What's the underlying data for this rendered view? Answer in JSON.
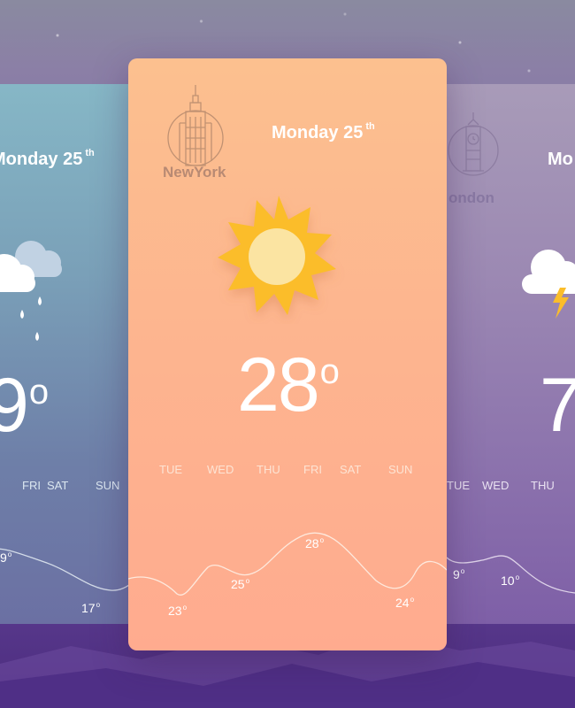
{
  "cards": {
    "left": {
      "date": "Monday 25",
      "date_suffix": "th",
      "temp_digit": "9",
      "temp_degree": "o",
      "days": [
        "FRI",
        "SAT",
        "SUN"
      ],
      "chart_labels": [
        {
          "value": "9",
          "deg": "o"
        },
        {
          "value": "17",
          "deg": "o"
        }
      ]
    },
    "center": {
      "date": "Monday 25",
      "date_suffix": "th",
      "city": "NewYork",
      "temp": "28",
      "temp_degree": "o",
      "days": [
        "TUE",
        "WED",
        "THU",
        "FRI",
        "SAT",
        "SUN"
      ],
      "chart_labels": [
        {
          "value": "23",
          "deg": "o"
        },
        {
          "value": "25",
          "deg": "o"
        },
        {
          "value": "28",
          "deg": "o"
        },
        {
          "value": "24",
          "deg": "o"
        }
      ]
    },
    "right": {
      "date": "Mo",
      "city": "ondon",
      "temp_digit": "7",
      "days": [
        "TUE",
        "WED",
        "THU"
      ],
      "chart_labels": [
        {
          "value": "9",
          "deg": "o"
        },
        {
          "value": "10",
          "deg": "o"
        }
      ]
    }
  },
  "icons": {
    "center_city": "empire-state-building-icon",
    "right_city": "big-ben-icon",
    "center_weather": "sun-icon",
    "left_weather": "rain-cloud-icon",
    "right_weather": "thunder-cloud-icon"
  },
  "colors": {
    "center_card": "#fdb48f",
    "left_card": "#7aa0b8",
    "right_card": "#9c89b3",
    "sun": "#fbbd2a",
    "sun_core": "#fbe4a2"
  }
}
